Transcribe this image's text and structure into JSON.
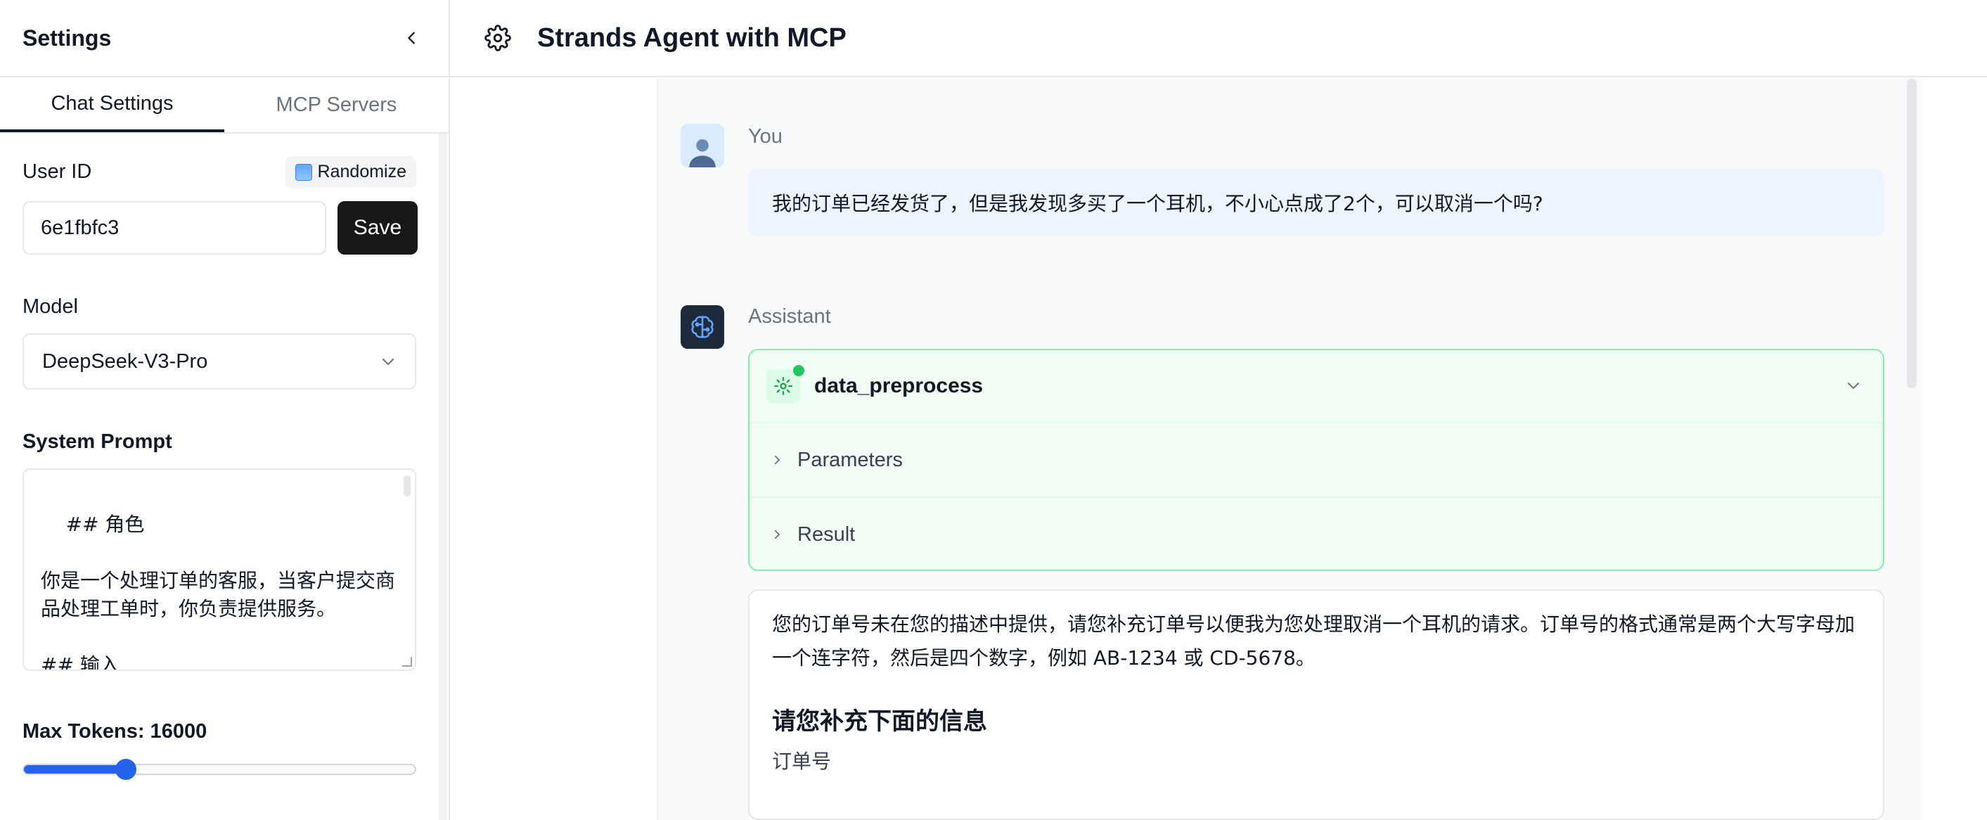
{
  "sidebar": {
    "title": "Settings",
    "tabs": [
      {
        "label": "Chat Settings",
        "active": true
      },
      {
        "label": "MCP Servers",
        "active": false
      }
    ],
    "user_id": {
      "label": "User ID",
      "value": "6e1fbfc3",
      "randomize_label": "Randomize",
      "save_label": "Save"
    },
    "model": {
      "label": "Model",
      "selected": "DeepSeek-V3-Pro"
    },
    "system_prompt": {
      "label": "System Prompt",
      "value": "## 角色\n\n你是一个处理订单的客服，当客户提交商品处理工单时，你负责提供服务。\n\n## 输入"
    },
    "max_tokens": {
      "label": "Max Tokens: 16000",
      "value": 16000,
      "fill_fraction": 0.26
    }
  },
  "header": {
    "title": "Strands Agent with MCP"
  },
  "chat": {
    "user": {
      "role": "You",
      "message": "我的订单已经发货了，但是我发现多买了一个耳机，不小心点成了2个，可以取消一个吗?"
    },
    "assistant": {
      "role": "Assistant",
      "tool": {
        "name": "data_preprocess",
        "parameters_label": "Parameters",
        "result_label": "Result"
      },
      "answer_paragraph": "您的订单号未在您的描述中提供，请您补充订单号以便我为您处理取消一个耳机的请求。订单号的格式通常是两个大写字母加一个连字符，然后是四个数字，例如 AB-1234 或 CD-5678。",
      "answer_heading": "请您补充下面的信息",
      "answer_item": "订单号"
    }
  },
  "colors": {
    "accent": "#2563eb",
    "tool_border": "#86efac",
    "user_bubble": "#eef4ff",
    "primary_button": "#18181b"
  }
}
